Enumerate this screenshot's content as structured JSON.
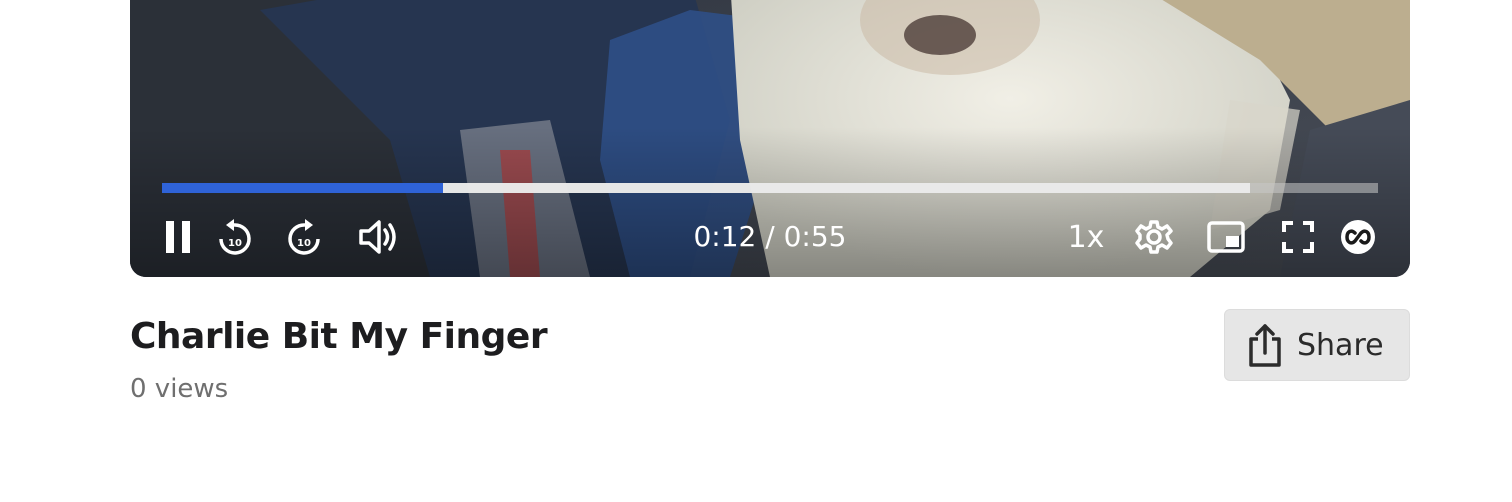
{
  "player": {
    "current_time": "0:12",
    "separator": " / ",
    "duration": "0:55",
    "time_display": "0:12 / 0:55",
    "progress_played_fraction": 0.231,
    "progress_buffered_fraction": 0.895,
    "speed_label": "1x",
    "skip_back_seconds": "10",
    "skip_forward_seconds": "10",
    "accent_color": "#2f63d8",
    "icons": {
      "pause": "pause-icon",
      "rewind": "rewind-10-icon",
      "forward": "forward-10-icon",
      "volume": "volume-icon",
      "settings": "gear-icon",
      "pip": "picture-in-picture-icon",
      "fullscreen": "fullscreen-icon",
      "loop": "loop-icon"
    }
  },
  "video": {
    "title": "Charlie Bit My Finger",
    "views": "0 views"
  },
  "share": {
    "label": "Share",
    "icon": "share-icon"
  }
}
